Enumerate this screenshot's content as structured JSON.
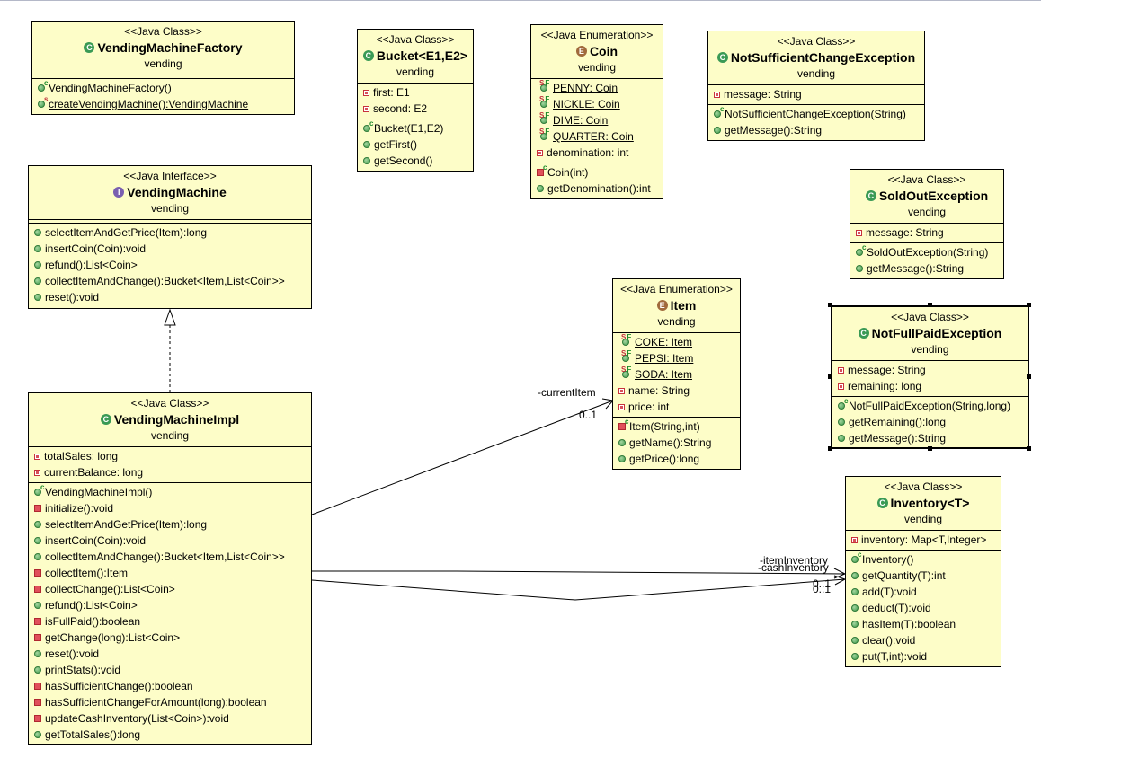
{
  "diagram": {
    "classes": {
      "factory": {
        "stereotype": "<<Java Class>>",
        "name": "VendingMachineFactory",
        "package": "vending",
        "kind": "class",
        "attributes": [],
        "methods": [
          {
            "text": "VendingMachineFactory()",
            "visibility": "constructor"
          },
          {
            "text": "createVendingMachine():VendingMachine",
            "visibility": "public-static"
          }
        ]
      },
      "bucket": {
        "stereotype": "<<Java Class>>",
        "name": "Bucket<E1,E2>",
        "package": "vending",
        "kind": "class",
        "attributes": [
          {
            "text": "first: E1",
            "visibility": "private"
          },
          {
            "text": "second: E2",
            "visibility": "private"
          }
        ],
        "methods": [
          {
            "text": "Bucket(E1,E2)",
            "visibility": "constructor"
          },
          {
            "text": "getFirst()",
            "visibility": "public"
          },
          {
            "text": "getSecond()",
            "visibility": "public"
          }
        ]
      },
      "coin": {
        "stereotype": "<<Java Enumeration>>",
        "name": "Coin",
        "package": "vending",
        "kind": "enum",
        "attributes": [
          {
            "text": "PENNY: Coin",
            "visibility": "static-final"
          },
          {
            "text": "NICKLE: Coin",
            "visibility": "static-final"
          },
          {
            "text": "DIME: Coin",
            "visibility": "static-final"
          },
          {
            "text": "QUARTER: Coin",
            "visibility": "static-final"
          },
          {
            "text": "denomination: int",
            "visibility": "private"
          }
        ],
        "methods": [
          {
            "text": "Coin(int)",
            "visibility": "private-constructor"
          },
          {
            "text": "getDenomination():int",
            "visibility": "public"
          }
        ]
      },
      "notSufficientChange": {
        "stereotype": "<<Java Class>>",
        "name": "NotSufficientChangeException",
        "package": "vending",
        "kind": "class",
        "attributes": [
          {
            "text": "message: String",
            "visibility": "private"
          }
        ],
        "methods": [
          {
            "text": "NotSufficientChangeException(String)",
            "visibility": "constructor"
          },
          {
            "text": "getMessage():String",
            "visibility": "public"
          }
        ]
      },
      "vendingMachine": {
        "stereotype": "<<Java Interface>>",
        "name": "VendingMachine",
        "package": "vending",
        "kind": "interface",
        "attributes": [],
        "methods": [
          {
            "text": "selectItemAndGetPrice(Item):long",
            "visibility": "public"
          },
          {
            "text": "insertCoin(Coin):void",
            "visibility": "public"
          },
          {
            "text": "refund():List<Coin>",
            "visibility": "public"
          },
          {
            "text": "collectItemAndChange():Bucket<Item,List<Coin>>",
            "visibility": "public"
          },
          {
            "text": "reset():void",
            "visibility": "public"
          }
        ]
      },
      "soldOut": {
        "stereotype": "<<Java Class>>",
        "name": "SoldOutException",
        "package": "vending",
        "kind": "class",
        "attributes": [
          {
            "text": "message: String",
            "visibility": "private"
          }
        ],
        "methods": [
          {
            "text": "SoldOutException(String)",
            "visibility": "constructor"
          },
          {
            "text": "getMessage():String",
            "visibility": "public"
          }
        ]
      },
      "notFullPaid": {
        "stereotype": "<<Java Class>>",
        "name": "NotFullPaidException",
        "package": "vending",
        "kind": "class",
        "attributes": [
          {
            "text": "message: String",
            "visibility": "private"
          },
          {
            "text": "remaining: long",
            "visibility": "private"
          }
        ],
        "methods": [
          {
            "text": "NotFullPaidException(String,long)",
            "visibility": "constructor"
          },
          {
            "text": "getRemaining():long",
            "visibility": "public"
          },
          {
            "text": "getMessage():String",
            "visibility": "public"
          }
        ]
      },
      "item": {
        "stereotype": "<<Java Enumeration>>",
        "name": "Item",
        "package": "vending",
        "kind": "enum",
        "attributes": [
          {
            "text": "COKE: Item",
            "visibility": "static-final"
          },
          {
            "text": "PEPSI: Item",
            "visibility": "static-final"
          },
          {
            "text": "SODA: Item",
            "visibility": "static-final"
          },
          {
            "text": "name: String",
            "visibility": "private"
          },
          {
            "text": "price: int",
            "visibility": "private"
          }
        ],
        "methods": [
          {
            "text": "Item(String,int)",
            "visibility": "private-constructor"
          },
          {
            "text": "getName():String",
            "visibility": "public"
          },
          {
            "text": "getPrice():long",
            "visibility": "public"
          }
        ]
      },
      "impl": {
        "stereotype": "<<Java Class>>",
        "name": "VendingMachineImpl",
        "package": "vending",
        "kind": "class",
        "attributes": [
          {
            "text": "totalSales: long",
            "visibility": "private"
          },
          {
            "text": "currentBalance: long",
            "visibility": "private"
          }
        ],
        "methods": [
          {
            "text": "VendingMachineImpl()",
            "visibility": "constructor"
          },
          {
            "text": "initialize():void",
            "visibility": "private-method"
          },
          {
            "text": "selectItemAndGetPrice(Item):long",
            "visibility": "public"
          },
          {
            "text": "insertCoin(Coin):void",
            "visibility": "public"
          },
          {
            "text": "collectItemAndChange():Bucket<Item,List<Coin>>",
            "visibility": "public"
          },
          {
            "text": "collectItem():Item",
            "visibility": "private-method"
          },
          {
            "text": "collectChange():List<Coin>",
            "visibility": "private-method"
          },
          {
            "text": "refund():List<Coin>",
            "visibility": "public"
          },
          {
            "text": "isFullPaid():boolean",
            "visibility": "private-method"
          },
          {
            "text": "getChange(long):List<Coin>",
            "visibility": "private-method"
          },
          {
            "text": "reset():void",
            "visibility": "public"
          },
          {
            "text": "printStats():void",
            "visibility": "public"
          },
          {
            "text": "hasSufficientChange():boolean",
            "visibility": "private-method"
          },
          {
            "text": "hasSufficientChangeForAmount(long):boolean",
            "visibility": "private-method"
          },
          {
            "text": "updateCashInventory(List<Coin>):void",
            "visibility": "private-method"
          },
          {
            "text": "getTotalSales():long",
            "visibility": "public"
          }
        ]
      },
      "inventory": {
        "stereotype": "<<Java Class>>",
        "name": "Inventory<T>",
        "package": "vending",
        "kind": "class",
        "attributes": [
          {
            "text": "inventory: Map<T,Integer>",
            "visibility": "private"
          }
        ],
        "methods": [
          {
            "text": "Inventory()",
            "visibility": "constructor"
          },
          {
            "text": "getQuantity(T):int",
            "visibility": "public"
          },
          {
            "text": "add(T):void",
            "visibility": "public"
          },
          {
            "text": "deduct(T):void",
            "visibility": "public"
          },
          {
            "text": "hasItem(T):boolean",
            "visibility": "public"
          },
          {
            "text": "clear():void",
            "visibility": "public"
          },
          {
            "text": "put(T,int):void",
            "visibility": "public"
          }
        ]
      }
    },
    "relations": [
      {
        "type": "realization",
        "from": "VendingMachineImpl",
        "to": "VendingMachine"
      },
      {
        "type": "association",
        "from": "VendingMachineImpl",
        "to": "Item",
        "role": "-currentItem",
        "multiplicity": "0..1"
      },
      {
        "type": "association",
        "from": "VendingMachineImpl",
        "to": "Inventory<T>",
        "role": "-itemInventory",
        "multiplicity": "0..1"
      },
      {
        "type": "association",
        "from": "VendingMachineImpl",
        "to": "Inventory<T>",
        "role": "-cashInventory",
        "multiplicity": "0..1"
      }
    ]
  }
}
